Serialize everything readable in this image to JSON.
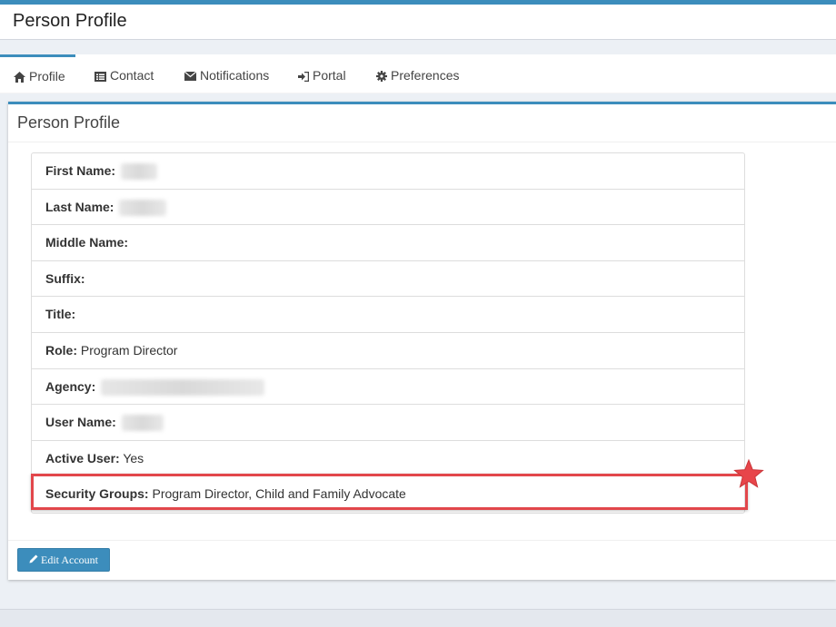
{
  "header": {
    "title": "Person Profile"
  },
  "tabs": [
    {
      "label": "Profile",
      "icon": "home-icon"
    },
    {
      "label": "Contact",
      "icon": "address-card-icon"
    },
    {
      "label": "Notifications",
      "icon": "envelope-icon"
    },
    {
      "label": "Portal",
      "icon": "sign-in-icon"
    },
    {
      "label": "Preferences",
      "icon": "gear-icon"
    }
  ],
  "profile": {
    "title": "Person Profile",
    "fields": [
      {
        "label": "First Name:",
        "value": ""
      },
      {
        "label": "Last Name:",
        "value": ""
      },
      {
        "label": "Middle Name:",
        "value": ""
      },
      {
        "label": "Suffix:",
        "value": ""
      },
      {
        "label": "Title:",
        "value": ""
      },
      {
        "label": "Role:",
        "value": "Program Director"
      },
      {
        "label": "Agency:",
        "value": ""
      },
      {
        "label": "User Name:",
        "value": ""
      },
      {
        "label": "Active User:",
        "value": "Yes"
      },
      {
        "label": "Security Groups:",
        "value": "Program Director, Child and Family Advocate"
      }
    ],
    "edit_button": "Edit Account"
  },
  "colors": {
    "accent": "#3c8dbc",
    "highlight": "#e2474b",
    "star": "#e8454a"
  }
}
